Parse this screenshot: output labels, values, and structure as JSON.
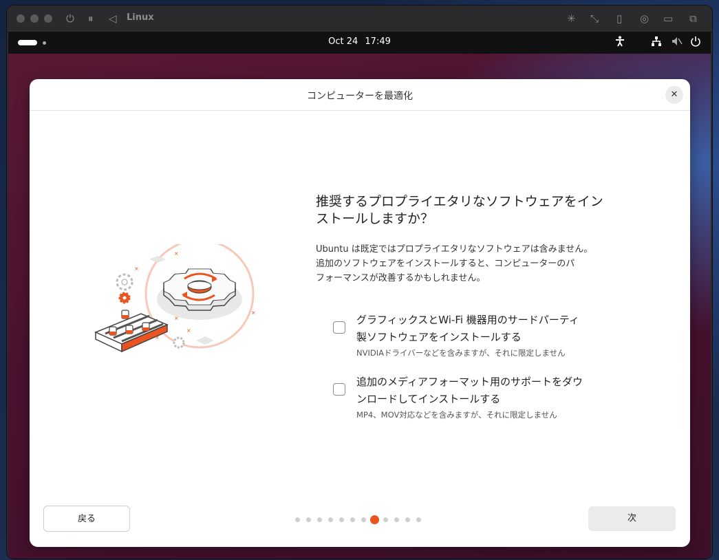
{
  "vm": {
    "title": "Linux"
  },
  "topbar": {
    "date": "Oct 24",
    "time": "17:49"
  },
  "dialog": {
    "title": "コンピューターを最適化",
    "question_line1": "推奨するプロプライエタリなソフトウェアをイン",
    "question_line2": "ストールしますか？",
    "desc_line1": "Ubuntu は既定ではプロプライエタリなソフトウェアは含みません。",
    "desc_line2": "追加のソフトウェアをインストールすると、コンピューターのパ",
    "desc_line3": "フォーマンスが改善するかもしれません。",
    "options": [
      {
        "line1": "グラフィックスとWi-Fi 機器用のサードパーティ",
        "line2": "製ソフトウェアをインストールする",
        "sub": "NVIDIAドライバーなどを含みますが、それに限定しません",
        "checked": false
      },
      {
        "line1": "追加のメディアフォーマット用のサポートをダウ",
        "line2": "ンロードしてインストールする",
        "sub": "MP4、MOV対応などを含みますが、それに限定しません",
        "checked": false
      }
    ],
    "back_label": "戻る",
    "next_label": "次",
    "pager": {
      "total": 12,
      "current": 8
    }
  },
  "colors": {
    "accent": "#e95420",
    "dialog_bg": "#ffffff"
  },
  "icons": {
    "close": "close-icon",
    "power": "power-icon",
    "pause": "pause-icon",
    "back": "back-triangle-icon",
    "accessibility": "accessibility-icon",
    "network": "network-icon",
    "volume": "volume-muted-icon",
    "system_power": "system-power-icon"
  }
}
